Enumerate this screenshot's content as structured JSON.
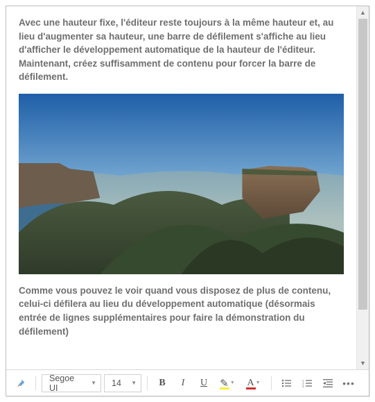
{
  "content": {
    "paragraph1": "Avec une hauteur fixe, l'éditeur reste toujours à la même hauteur et, au lieu d'augmenter sa hauteur, une barre de défilement s'affiche au lieu d'afficher le développement automatique de la hauteur de l'éditeur. Maintenant, créez suffisamment de contenu pour forcer la barre de défilement.",
    "image_alt": "landscape-mountains",
    "paragraph2": "Comme vous pouvez le voir quand vous disposez de plus de contenu, celui-ci défilera au lieu du développement automatique (désormais entrée de lignes supplémentaires pour faire la démonstration du défilement)"
  },
  "toolbar": {
    "font_family": "Segoe UI",
    "font_size": "14",
    "bold_label": "B",
    "italic_label": "I",
    "underline_label": "U",
    "fontcolor_label": "A"
  },
  "scrollbar": {
    "up_glyph": "▲",
    "down_glyph": "▼"
  }
}
